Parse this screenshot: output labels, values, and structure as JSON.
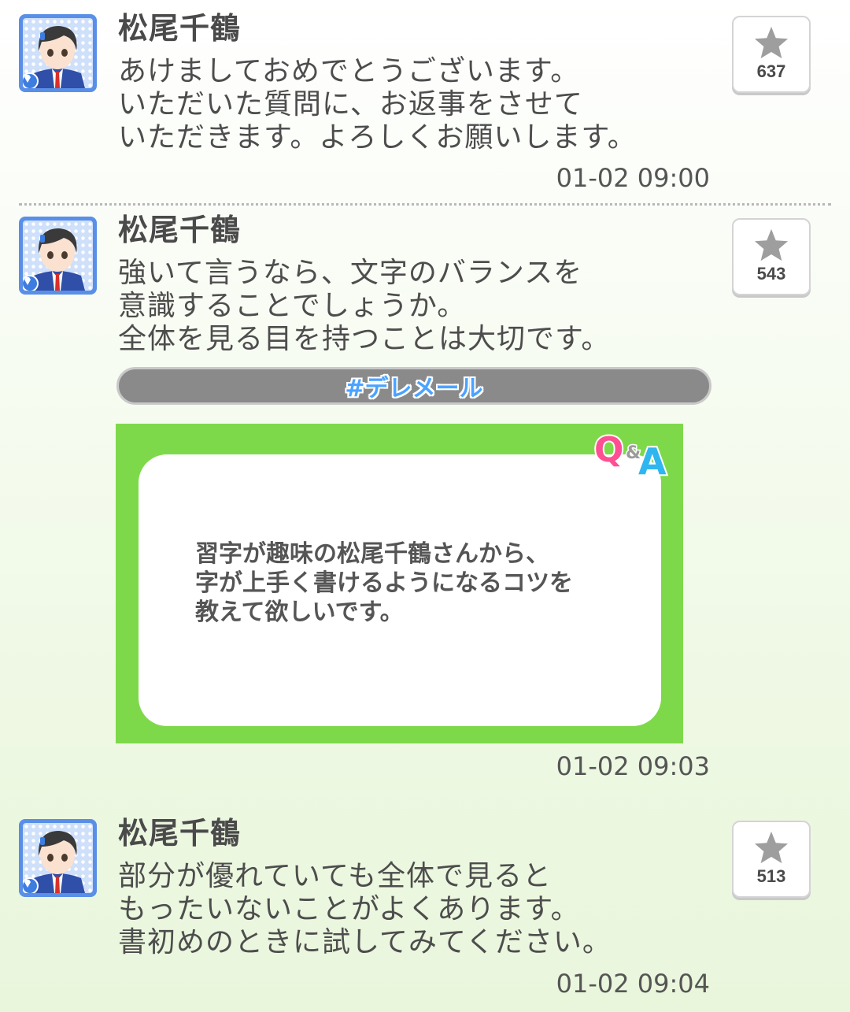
{
  "posts": [
    {
      "author": "松尾千鶴",
      "message": "あけましておめでとうございます。\nいただいた質問に、お返事をさせて\nいただきます。よろしくお願いします。",
      "timestamp": "01-02 09:00",
      "likes": "637"
    },
    {
      "author": "松尾千鶴",
      "message": "強いて言うなら、文字のバランスを\n意識することでしょうか。\n全体を見る目を持つことは大切です。",
      "hashtag": "#デレメール",
      "qa_card": {
        "question": "習字が趣味の松尾千鶴さんから、\n字が上手く書けるようになるコツを\n教えて欲しいです。",
        "logo_q": "Q",
        "logo_amp": "&",
        "logo_a": "A"
      },
      "timestamp": "01-02 09:03",
      "likes": "543"
    },
    {
      "author": "松尾千鶴",
      "message": "部分が優れていても全体で見ると\nもったいないことがよくあります。\n書初めのときに試してみてください。",
      "timestamp": "01-02 09:04",
      "likes": "513"
    }
  ],
  "colors": {
    "accent_green": "#7ed94a",
    "hashtag_blue": "#4aa3ff",
    "avatar_frame": "#5a8fe8"
  },
  "icons": {
    "like": "star-icon",
    "avatar_badge": "gem-icon"
  }
}
